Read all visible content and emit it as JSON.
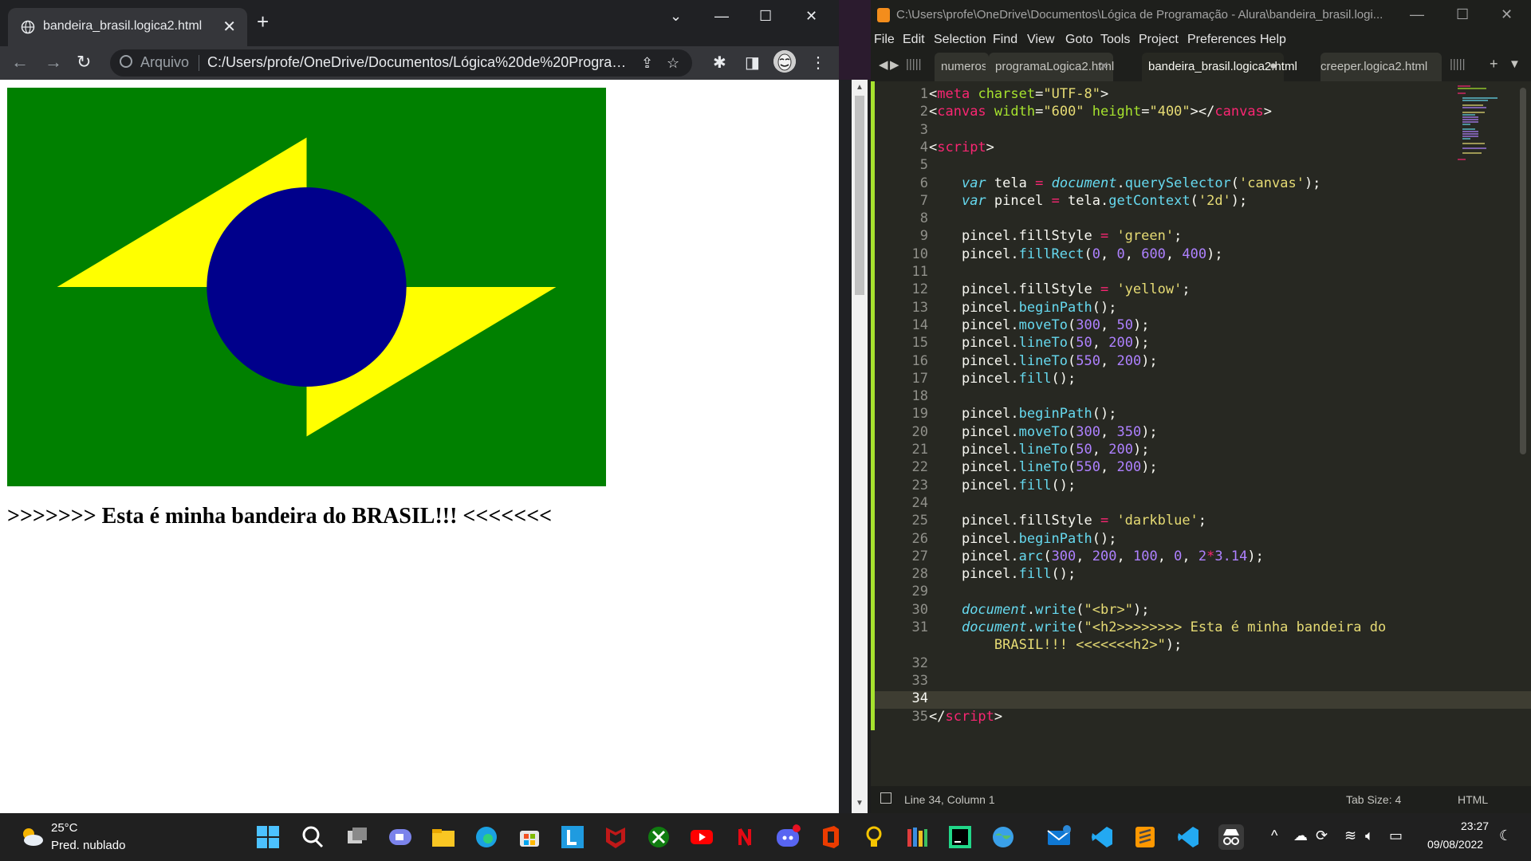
{
  "browser": {
    "tab_title": "bandeira_brasil.logica2.html",
    "new_tab_icon": "plus-icon",
    "omnibox_label": "Arquivo",
    "url": "C:/Users/profe/OneDrive/Documentos/Lógica%20de%20Programa...",
    "flag_colors": {
      "field": "#008000",
      "rhombus": "#ffff00",
      "circle": "#00008b"
    },
    "heading": ">>>>>>> Esta é minha bandeira do BRASIL!!! <<<<<<<"
  },
  "editor": {
    "window_title": "C:\\Users\\profe\\OneDrive\\Documentos\\Lógica de Programação - Alura\\bandeira_brasil.logi...",
    "menu": [
      "File",
      "Edit",
      "Selection",
      "Find",
      "View",
      "Goto",
      "Tools",
      "Project",
      "Preferences",
      "Help"
    ],
    "tabs": [
      {
        "label": "numeros_p"
      },
      {
        "label": "programaLogica2.html"
      },
      {
        "label": "bandeira_brasil.logica2.html"
      },
      {
        "label": "creeper.logica2.html"
      }
    ],
    "line_numbers": [
      "1",
      "2",
      "3",
      "4",
      "5",
      "6",
      "7",
      "8",
      "9",
      "10",
      "11",
      "12",
      "13",
      "14",
      "15",
      "16",
      "17",
      "18",
      "19",
      "20",
      "21",
      "22",
      "23",
      "24",
      "25",
      "26",
      "27",
      "28",
      "29",
      "30",
      "31",
      "",
      "32",
      "33",
      "34",
      "35"
    ],
    "status": {
      "position": "Line 34, Column 1",
      "tab_size": "Tab Size: 4",
      "syntax": "HTML"
    }
  },
  "taskbar": {
    "weather_temp": "25°C",
    "weather_desc": "Pred. nublado",
    "time": "23:27",
    "date": "09/08/2022"
  }
}
